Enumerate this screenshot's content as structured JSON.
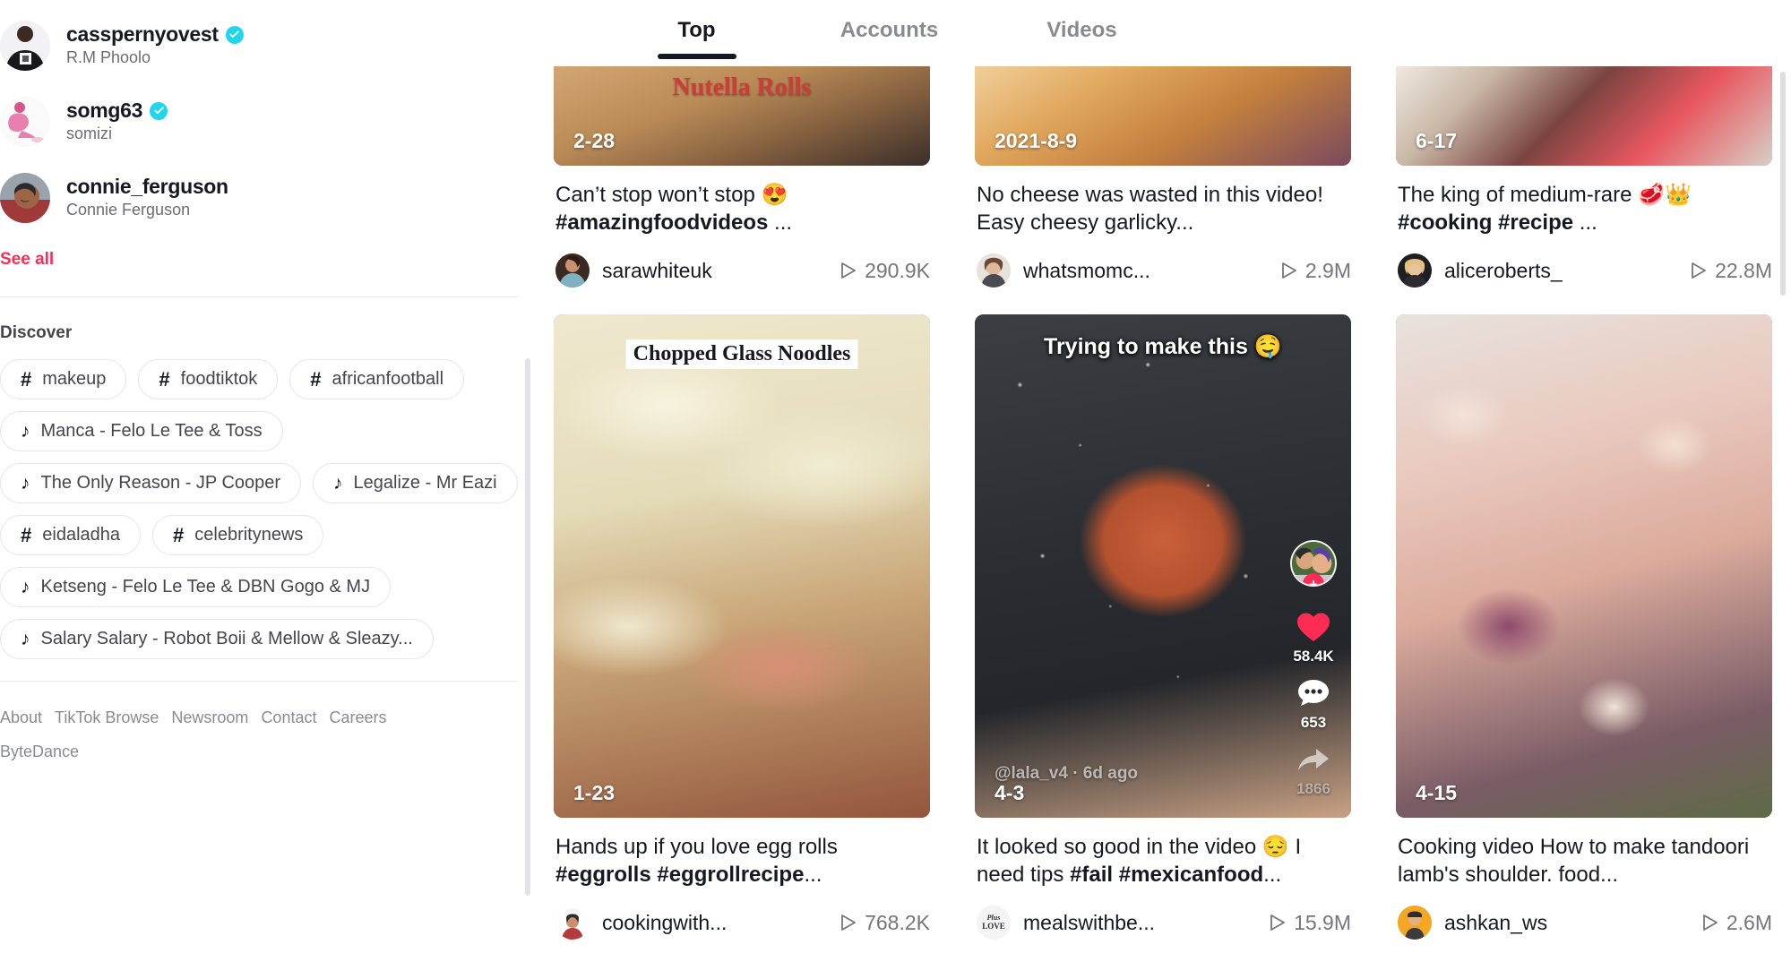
{
  "sidebar": {
    "suggested_accounts": [
      {
        "username": "casspernyovest",
        "display_name": "R.M Phoolo",
        "verified": true,
        "avatar_colors": [
          "#2b2b2f",
          "#d8c4b0"
        ]
      },
      {
        "username": "somg63",
        "display_name": "somizi",
        "verified": true,
        "avatar_colors": [
          "#f3f3f5",
          "#e87fae"
        ]
      },
      {
        "username": "connie_ferguson",
        "display_name": "Connie Ferguson",
        "verified": false,
        "avatar_colors": [
          "#8c5a48",
          "#b24a3e"
        ]
      }
    ],
    "see_all_label": "See all",
    "discover_title": "Discover",
    "discover_tags": [
      {
        "label": "makeup",
        "type": "hashtag"
      },
      {
        "label": "foodtiktok",
        "type": "hashtag"
      },
      {
        "label": "africanfootball",
        "type": "hashtag"
      },
      {
        "label": "Manca - Felo Le Tee & Toss",
        "type": "music"
      },
      {
        "label": "The Only Reason - JP Cooper",
        "type": "music"
      },
      {
        "label": "Legalize - Mr Eazi",
        "type": "music"
      },
      {
        "label": "eidaladha",
        "type": "hashtag"
      },
      {
        "label": "celebritynews",
        "type": "hashtag"
      },
      {
        "label": "Ketseng - Felo Le Tee & DBN Gogo & MJ",
        "type": "music"
      },
      {
        "label": "Salary Salary - Robot Boii & Mellow & Sleazy...",
        "type": "music"
      }
    ],
    "footer_links": [
      "About",
      "TikTok Browse",
      "Newsroom",
      "Contact",
      "Careers",
      "ByteDance"
    ]
  },
  "main": {
    "tabs": [
      {
        "label": "Top",
        "active": true
      },
      {
        "label": "Accounts",
        "active": false
      },
      {
        "label": "Videos",
        "active": false
      }
    ],
    "videos": [
      {
        "date_badge": "2-28",
        "overlay_text": "Nutella Rolls",
        "overlay_style": "serif-red",
        "caption_plain": "Can’t stop won’t stop 😍 ",
        "caption_bold": "#amazingfoodvideos",
        "caption_tail": " ...",
        "author": "sarawhiteuk",
        "plays": "290.9K",
        "avatar_colors": [
          "#3a2a22",
          "#c98f6e"
        ],
        "thumb_colors": [
          "#c49a6c",
          "#8a6442",
          "#e8d4b8"
        ]
      },
      {
        "date_badge": "2021-8-9",
        "overlay_text": "",
        "overlay_style": "none",
        "caption_plain": "No cheese was wasted in this video! Easy cheesy garlicky...",
        "caption_bold": "",
        "caption_tail": "",
        "author": "whatsmomc...",
        "plays": "2.9M",
        "avatar_colors": [
          "#cbb09a",
          "#7b4f3a"
        ],
        "thumb_colors": [
          "#e0a65c",
          "#c27f3e",
          "#f0cf9a"
        ]
      },
      {
        "date_badge": "6-17",
        "overlay_text": "",
        "overlay_style": "none",
        "caption_plain": "The king of medium-rare 🥩👑 ",
        "caption_bold": "#cooking #recipe",
        "caption_tail": " ...",
        "author": "aliceroberts_",
        "plays": "22.8M",
        "avatar_colors": [
          "#e4c89a",
          "#a8744a"
        ],
        "thumb_colors": [
          "#d8d2cb",
          "#8c4b46",
          "#e8565f"
        ]
      },
      {
        "date_badge": "1-23",
        "overlay_text": "Chopped Glass Noodles",
        "overlay_style": "white-box",
        "caption_plain": "Hands up if you love egg rolls ",
        "caption_bold": "#eggrolls #eggrollrecipe",
        "caption_tail": "...",
        "author": "cookingwith...",
        "plays": "768.2K",
        "avatar_colors": [
          "#f4f4f6",
          "#2c2c30"
        ],
        "thumb_colors": [
          "#efe8cf",
          "#cfc49a",
          "#b5764f"
        ]
      },
      {
        "date_badge": "4-3",
        "overlay_text": "Trying to make this 🤤",
        "overlay_style": "bold-white",
        "handle_overlay": "@lala_v4 · 6d ago",
        "caption_plain": "It looked so good in the video 😔 I need tips ",
        "caption_bold": "#fail #mexicanfood",
        "caption_tail": "...",
        "author": "mealswithbe...",
        "plays": "15.9M",
        "avatar_colors": [
          "#f2f2f2",
          "#3a3a3c"
        ],
        "thumb_colors": [
          "#2e3033",
          "#1c1e20",
          "#c2602c"
        ],
        "rail": {
          "like_count": "58.4K",
          "comment_count": "653",
          "share_count": "1866"
        }
      },
      {
        "date_badge": "4-15",
        "overlay_text": "",
        "overlay_style": "none",
        "caption_plain": "Cooking video How to make tandoori lamb's shoulder. food...",
        "caption_bold": "",
        "caption_tail": "",
        "author": "ashkan_ws",
        "plays": "2.6M",
        "avatar_colors": [
          "#f5a623",
          "#3b3b3d"
        ],
        "thumb_colors": [
          "#e9c9bf",
          "#8e4a6e",
          "#6b8f4a"
        ]
      }
    ]
  },
  "colors": {
    "accent_pink": "#fe2c55",
    "verified_blue": "#20d5ec",
    "text_primary": "#161823",
    "text_secondary": "#8a8b91"
  }
}
